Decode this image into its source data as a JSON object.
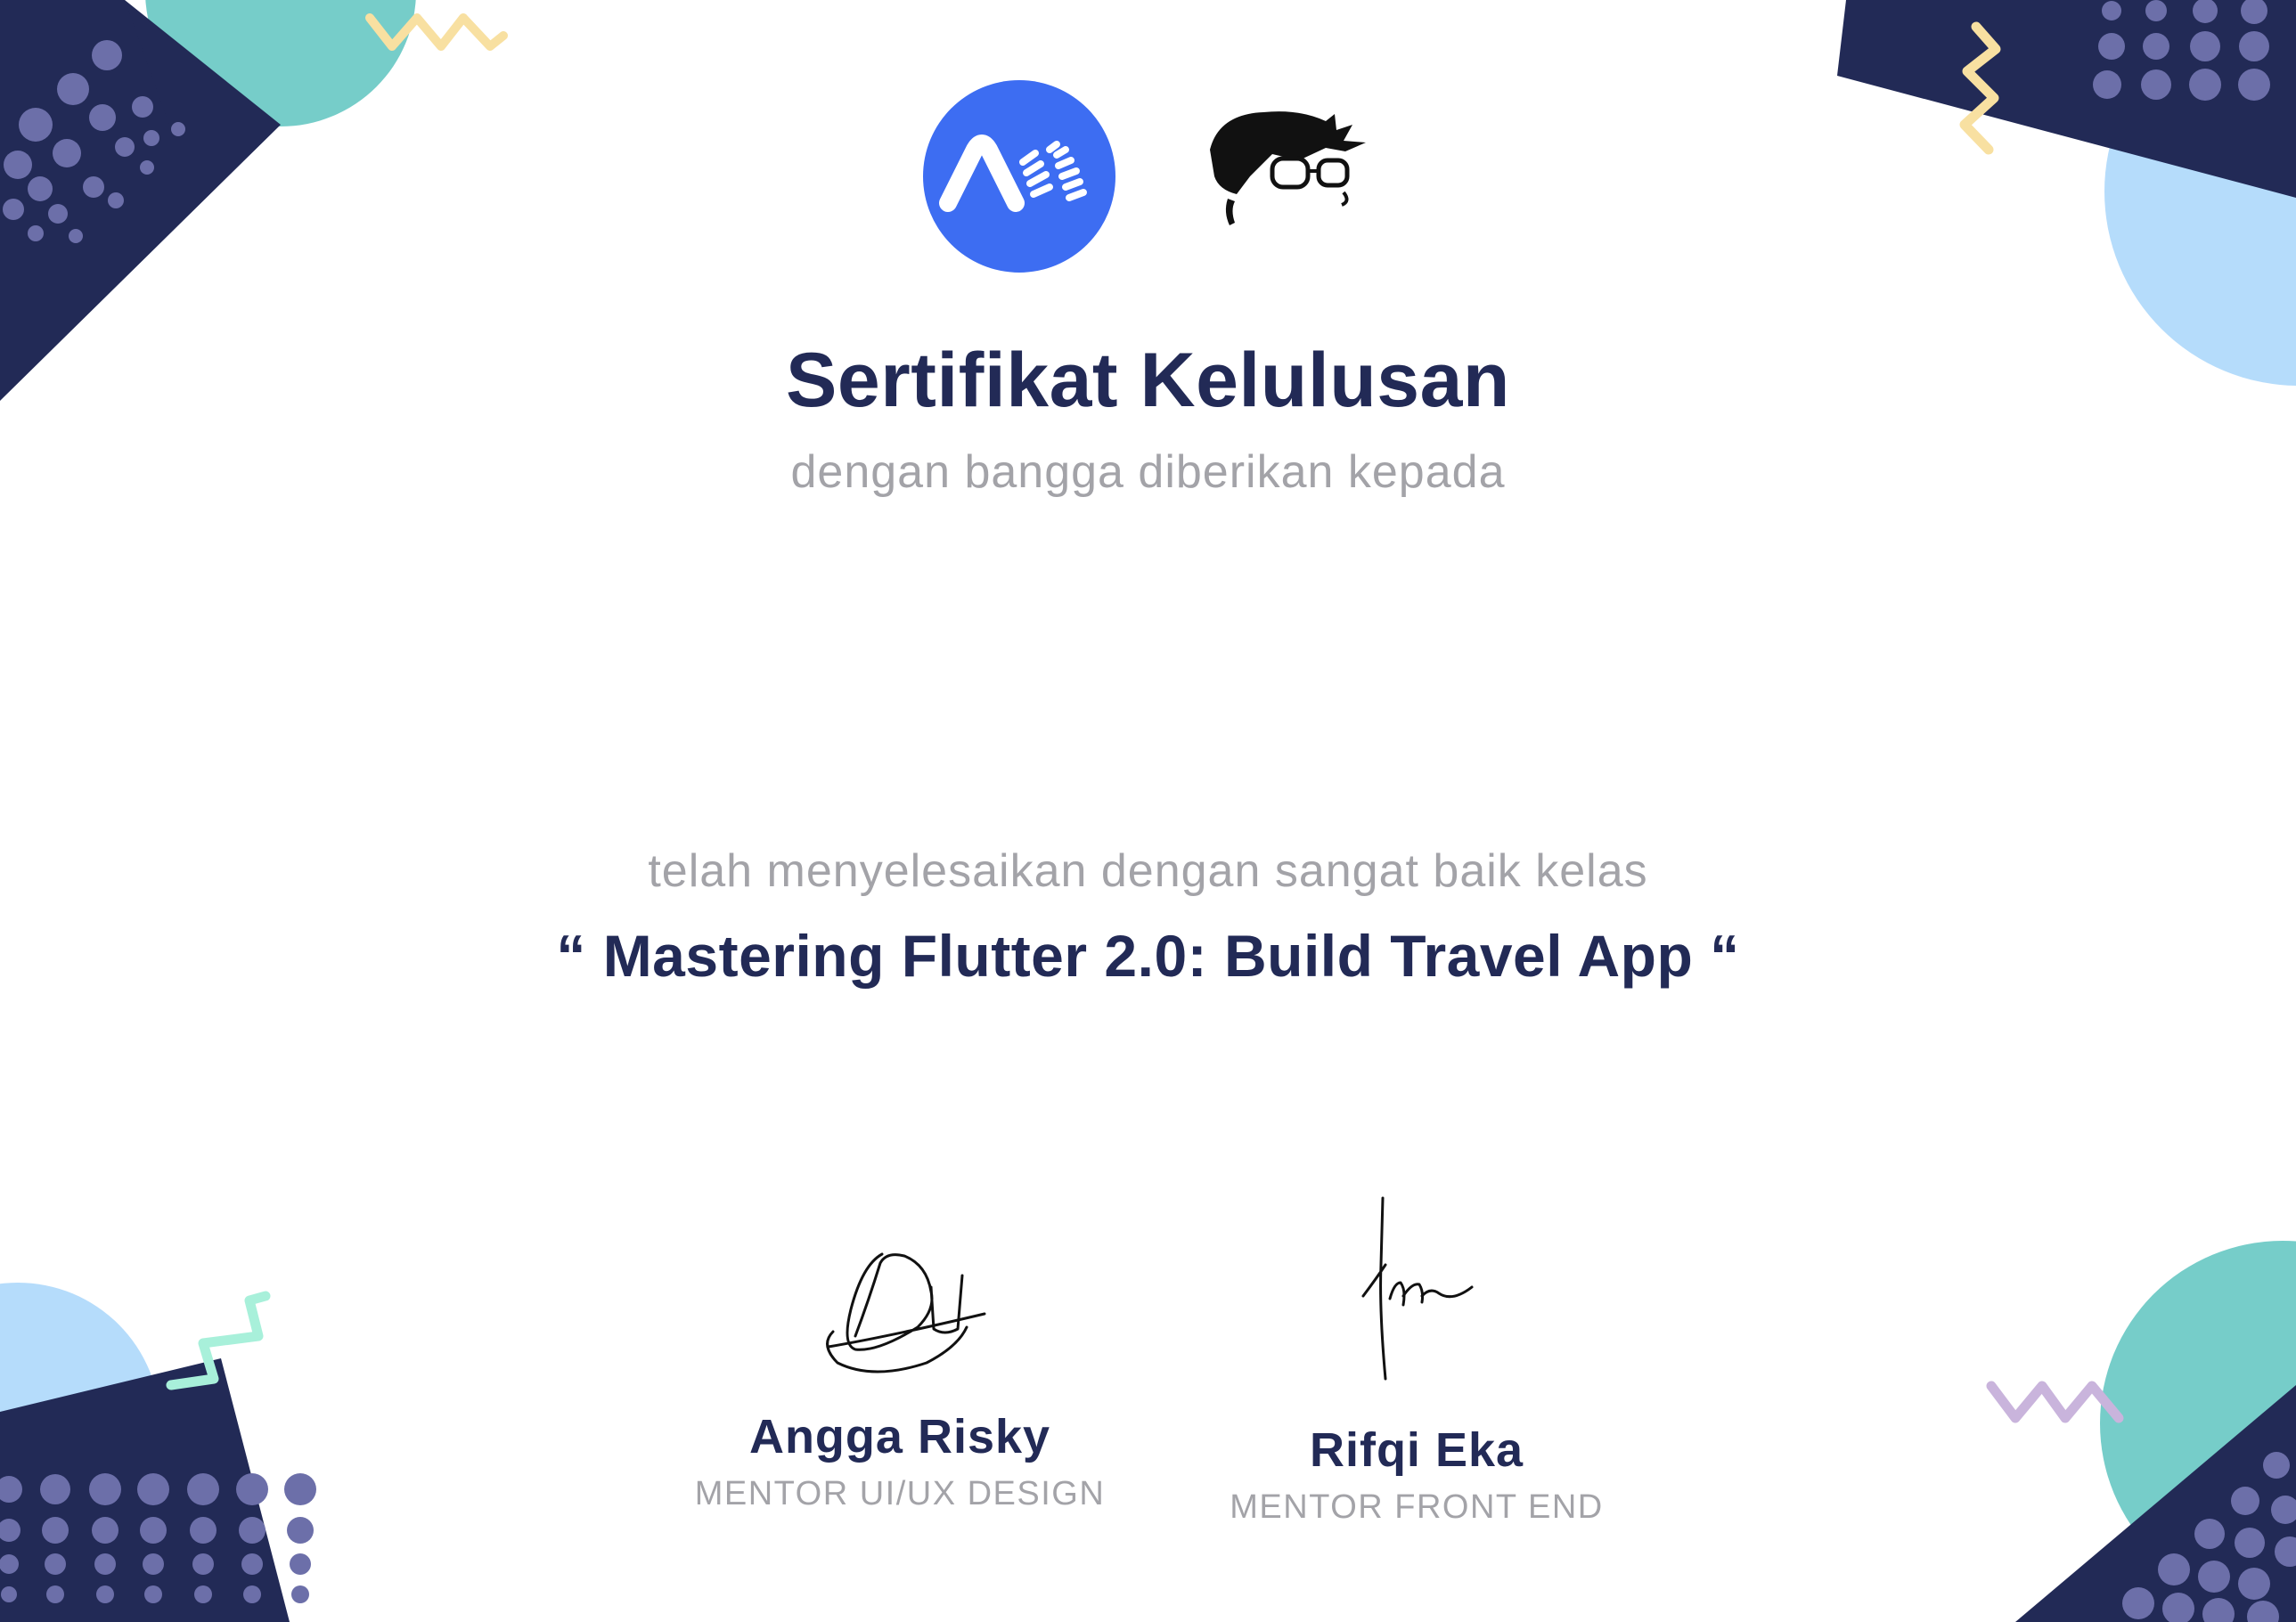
{
  "certificate": {
    "title": "Sertifikat Kelulusan",
    "subtitle": "dengan bangga diberikan kepada",
    "completion_text": "telah menyelesaikan dengan sangat baik kelas",
    "course_title": "“ Mastering Flutter 2.0: Build Travel App “"
  },
  "signatories": [
    {
      "name": "Angga Risky",
      "role": "MENTOR UI/UX DESIGN"
    },
    {
      "name": "Rifqi Eka",
      "role": "MENTOR FRONT END"
    }
  ],
  "logos": [
    "brand-logo",
    "mascot-face-logo"
  ],
  "colors": {
    "navy": "#222a56",
    "brand_blue": "#3d6df2",
    "teal": "#76cdc9",
    "light_blue": "#b5dcfb",
    "dots": "#6c6fa9",
    "yellow": "#f8e0a1",
    "mint": "#a8f0da",
    "lavender": "#c9b4dc",
    "gray_text": "#a3a3a8"
  }
}
